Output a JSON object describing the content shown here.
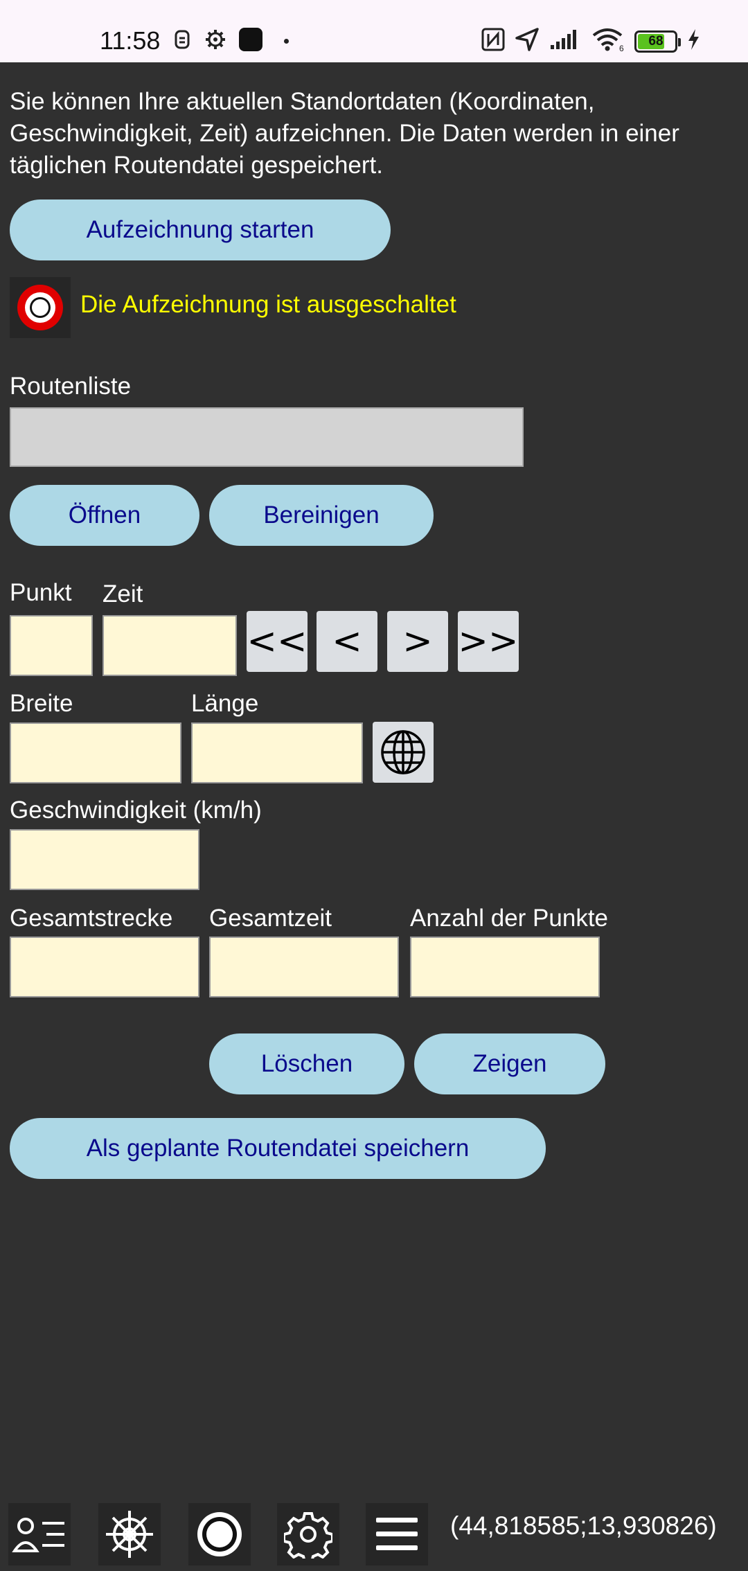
{
  "status_bar": {
    "time": "11:58",
    "battery_level": "68",
    "battery_fraction": 0.68,
    "battery_color": "#5ac21e"
  },
  "intro_text": "Sie können Ihre aktuellen Standortdaten (Koordinaten, Geschwindigkeit, Zeit) aufzeichnen. Die Daten werden in einer täglichen Routendatei gespeichert.",
  "buttons": {
    "start_recording": "Aufzeichnung starten",
    "open": "Öffnen",
    "clean": "Bereinigen",
    "delete": "Löschen",
    "show": "Zeigen",
    "save_planned": "Als geplante Routendatei speichern"
  },
  "recording_status": "Die Aufzeichnung ist ausgeschaltet",
  "labels": {
    "route_list": "Routenliste",
    "point": "Punkt",
    "time": "Zeit",
    "latitude": "Breite",
    "longitude": "Länge",
    "speed": "Geschwindigkeit (km/h)",
    "total_distance": "Gesamtstrecke",
    "total_time": "Gesamtzeit",
    "point_count": "Anzahl der Punkte"
  },
  "nav_buttons": {
    "first": "<<",
    "prev": "<",
    "next": ">",
    "last": ">>"
  },
  "coordinates": "(44,818585;13,930826)",
  "colors": {
    "background": "#303030",
    "button_bg": "#add8e6",
    "button_text": "#0a0a8c",
    "field_bg": "#fff8d6",
    "status_yellow": "#ffff00"
  },
  "bottom_icons": [
    "user-list-icon",
    "helm-icon",
    "record-icon",
    "gear-icon",
    "menu-icon"
  ]
}
